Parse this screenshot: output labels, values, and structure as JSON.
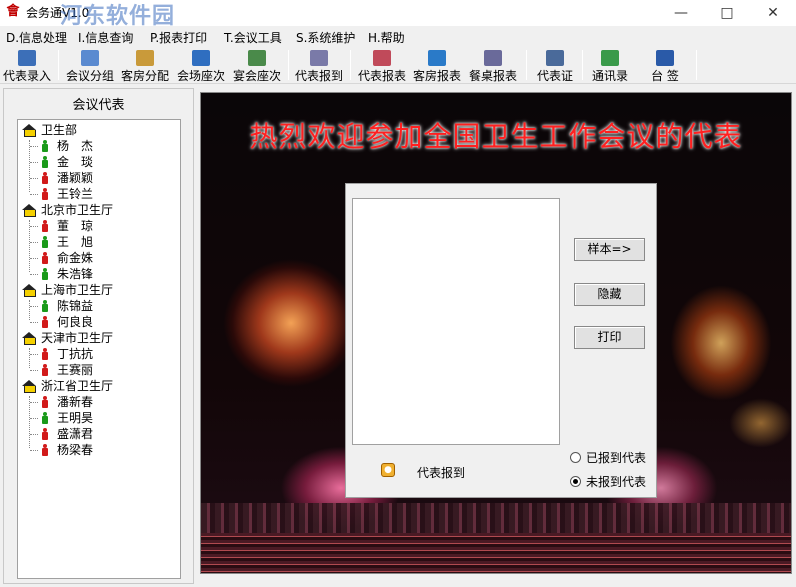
{
  "window": {
    "title": "会务通V1.0",
    "watermark": "河东软件园"
  },
  "menu": [
    "D.信息处理",
    "I.信息查询",
    "P.报表打印",
    "T.会议工具",
    "S.系统维护",
    "H.帮助"
  ],
  "toolbar": [
    {
      "label": "代表录入",
      "icon": "user-add-icon"
    },
    {
      "label": "会议分组",
      "icon": "group-icon"
    },
    {
      "label": "客房分配",
      "icon": "room-icon"
    },
    {
      "label": "会场座次",
      "icon": "hall-seat-icon"
    },
    {
      "label": "宴会座次",
      "icon": "banquet-seat-icon"
    },
    {
      "label": "代表报到",
      "icon": "register-icon"
    },
    {
      "label": "代表报表",
      "icon": "report-icon"
    },
    {
      "label": "客房报表",
      "icon": "room-report-icon"
    },
    {
      "label": "餐桌报表",
      "icon": "table-report-icon"
    },
    {
      "label": "代表证",
      "icon": "badge-icon"
    },
    {
      "label": "通讯录",
      "icon": "contacts-icon"
    },
    {
      "label": "台   签",
      "icon": "table-card-icon"
    }
  ],
  "left_panel": {
    "title": "会议代表",
    "groups": [
      {
        "name": "卫生部",
        "members": [
          {
            "name": "杨　杰",
            "gender": "male"
          },
          {
            "name": "金　琰",
            "gender": "male"
          },
          {
            "name": "潘颖颖",
            "gender": "female"
          },
          {
            "name": "王铃兰",
            "gender": "female"
          }
        ]
      },
      {
        "name": "北京市卫生厅",
        "members": [
          {
            "name": "董　琼",
            "gender": "female"
          },
          {
            "name": "王　旭",
            "gender": "male"
          },
          {
            "name": "俞金姝",
            "gender": "female"
          },
          {
            "name": "朱浩锋",
            "gender": "male"
          }
        ]
      },
      {
        "name": "上海市卫生厅",
        "members": [
          {
            "name": "陈锦益",
            "gender": "male"
          },
          {
            "name": "何良良",
            "gender": "female"
          }
        ]
      },
      {
        "name": "天津市卫生厅",
        "members": [
          {
            "name": "丁抗抗",
            "gender": "female"
          },
          {
            "name": "王赛丽",
            "gender": "female"
          }
        ]
      },
      {
        "name": "浙江省卫生厅",
        "members": [
          {
            "name": "潘新春",
            "gender": "female"
          },
          {
            "name": "王明昊",
            "gender": "male"
          },
          {
            "name": "盛潇君",
            "gender": "female"
          },
          {
            "name": "杨梁春",
            "gender": "female"
          }
        ]
      }
    ]
  },
  "main": {
    "banner": "热烈欢迎参加全国卫生工作会议的代表"
  },
  "dialog": {
    "buttons": {
      "sample": "样本=>",
      "hide": "隐藏",
      "print": "打印"
    },
    "report_label": "代表报到",
    "radio_registered": "已报到代表",
    "radio_unregistered": "未报到代表",
    "selected": "unregistered"
  },
  "colors": {
    "banner": "#ff2020",
    "male": "#1a9a1a",
    "female": "#d11a1a"
  }
}
